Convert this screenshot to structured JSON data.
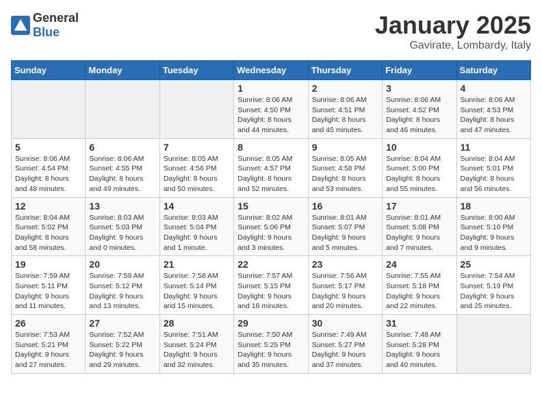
{
  "logo": {
    "general": "General",
    "blue": "Blue"
  },
  "header": {
    "month": "January 2025",
    "location": "Gavirate, Lombardy, Italy"
  },
  "weekdays": [
    "Sunday",
    "Monday",
    "Tuesday",
    "Wednesday",
    "Thursday",
    "Friday",
    "Saturday"
  ],
  "weeks": [
    [
      {
        "day": "",
        "info": ""
      },
      {
        "day": "",
        "info": ""
      },
      {
        "day": "",
        "info": ""
      },
      {
        "day": "1",
        "info": "Sunrise: 8:06 AM\nSunset: 4:50 PM\nDaylight: 8 hours and 44 minutes."
      },
      {
        "day": "2",
        "info": "Sunrise: 8:06 AM\nSunset: 4:51 PM\nDaylight: 8 hours and 45 minutes."
      },
      {
        "day": "3",
        "info": "Sunrise: 8:06 AM\nSunset: 4:52 PM\nDaylight: 8 hours and 46 minutes."
      },
      {
        "day": "4",
        "info": "Sunrise: 8:06 AM\nSunset: 4:53 PM\nDaylight: 8 hours and 47 minutes."
      }
    ],
    [
      {
        "day": "5",
        "info": "Sunrise: 8:06 AM\nSunset: 4:54 PM\nDaylight: 8 hours and 48 minutes."
      },
      {
        "day": "6",
        "info": "Sunrise: 8:06 AM\nSunset: 4:55 PM\nDaylight: 8 hours and 49 minutes."
      },
      {
        "day": "7",
        "info": "Sunrise: 8:05 AM\nSunset: 4:56 PM\nDaylight: 8 hours and 50 minutes."
      },
      {
        "day": "8",
        "info": "Sunrise: 8:05 AM\nSunset: 4:57 PM\nDaylight: 8 hours and 52 minutes."
      },
      {
        "day": "9",
        "info": "Sunrise: 8:05 AM\nSunset: 4:58 PM\nDaylight: 8 hours and 53 minutes."
      },
      {
        "day": "10",
        "info": "Sunrise: 8:04 AM\nSunset: 5:00 PM\nDaylight: 8 hours and 55 minutes."
      },
      {
        "day": "11",
        "info": "Sunrise: 8:04 AM\nSunset: 5:01 PM\nDaylight: 8 hours and 56 minutes."
      }
    ],
    [
      {
        "day": "12",
        "info": "Sunrise: 8:04 AM\nSunset: 5:02 PM\nDaylight: 8 hours and 58 minutes."
      },
      {
        "day": "13",
        "info": "Sunrise: 8:03 AM\nSunset: 5:03 PM\nDaylight: 9 hours and 0 minutes."
      },
      {
        "day": "14",
        "info": "Sunrise: 8:03 AM\nSunset: 5:04 PM\nDaylight: 9 hours and 1 minute."
      },
      {
        "day": "15",
        "info": "Sunrise: 8:02 AM\nSunset: 5:06 PM\nDaylight: 9 hours and 3 minutes."
      },
      {
        "day": "16",
        "info": "Sunrise: 8:01 AM\nSunset: 5:07 PM\nDaylight: 9 hours and 5 minutes."
      },
      {
        "day": "17",
        "info": "Sunrise: 8:01 AM\nSunset: 5:08 PM\nDaylight: 9 hours and 7 minutes."
      },
      {
        "day": "18",
        "info": "Sunrise: 8:00 AM\nSunset: 5:10 PM\nDaylight: 9 hours and 9 minutes."
      }
    ],
    [
      {
        "day": "19",
        "info": "Sunrise: 7:59 AM\nSunset: 5:11 PM\nDaylight: 9 hours and 11 minutes."
      },
      {
        "day": "20",
        "info": "Sunrise: 7:59 AM\nSunset: 5:12 PM\nDaylight: 9 hours and 13 minutes."
      },
      {
        "day": "21",
        "info": "Sunrise: 7:58 AM\nSunset: 5:14 PM\nDaylight: 9 hours and 15 minutes."
      },
      {
        "day": "22",
        "info": "Sunrise: 7:57 AM\nSunset: 5:15 PM\nDaylight: 9 hours and 18 minutes."
      },
      {
        "day": "23",
        "info": "Sunrise: 7:56 AM\nSunset: 5:17 PM\nDaylight: 9 hours and 20 minutes."
      },
      {
        "day": "24",
        "info": "Sunrise: 7:55 AM\nSunset: 5:18 PM\nDaylight: 9 hours and 22 minutes."
      },
      {
        "day": "25",
        "info": "Sunrise: 7:54 AM\nSunset: 5:19 PM\nDaylight: 9 hours and 25 minutes."
      }
    ],
    [
      {
        "day": "26",
        "info": "Sunrise: 7:53 AM\nSunset: 5:21 PM\nDaylight: 9 hours and 27 minutes."
      },
      {
        "day": "27",
        "info": "Sunrise: 7:52 AM\nSunset: 5:22 PM\nDaylight: 9 hours and 29 minutes."
      },
      {
        "day": "28",
        "info": "Sunrise: 7:51 AM\nSunset: 5:24 PM\nDaylight: 9 hours and 32 minutes."
      },
      {
        "day": "29",
        "info": "Sunrise: 7:50 AM\nSunset: 5:25 PM\nDaylight: 9 hours and 35 minutes."
      },
      {
        "day": "30",
        "info": "Sunrise: 7:49 AM\nSunset: 5:27 PM\nDaylight: 9 hours and 37 minutes."
      },
      {
        "day": "31",
        "info": "Sunrise: 7:48 AM\nSunset: 5:28 PM\nDaylight: 9 hours and 40 minutes."
      },
      {
        "day": "",
        "info": ""
      }
    ]
  ]
}
